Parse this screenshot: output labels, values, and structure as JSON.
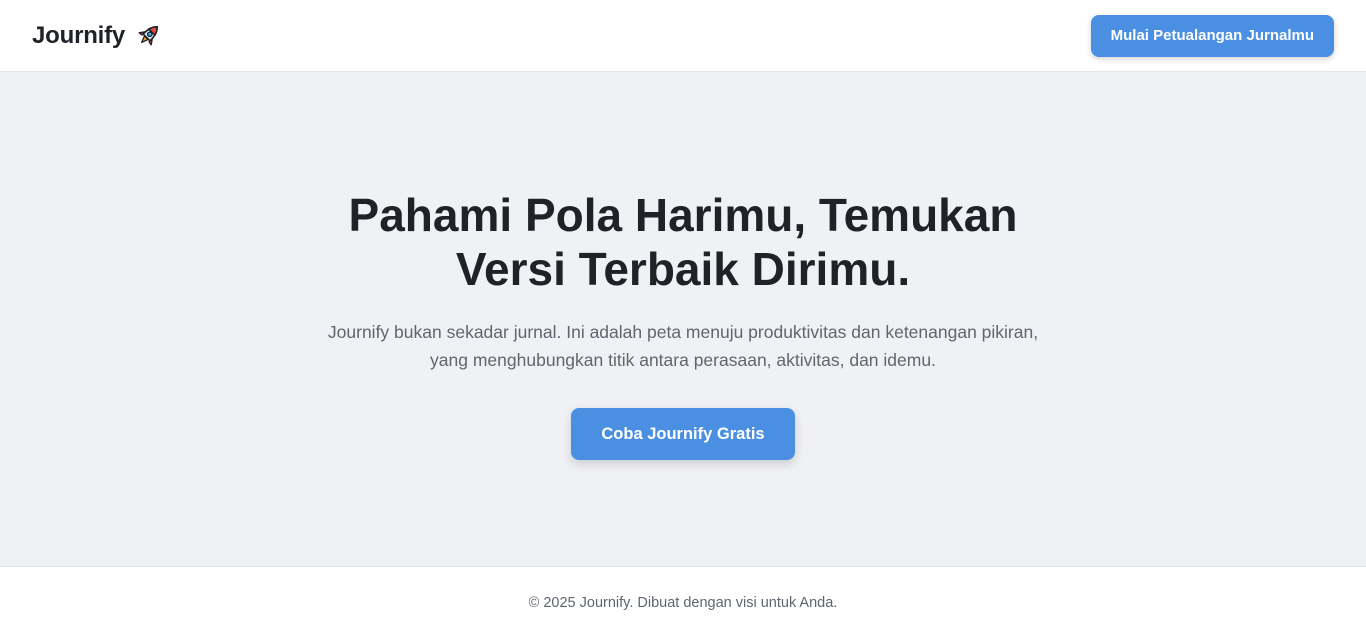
{
  "header": {
    "brand": "Journify",
    "brand_icon": "rocket-icon",
    "cta_label": "Mulai Petualangan Jurnalmu"
  },
  "hero": {
    "title": "Pahami Pola Harimu, Temukan Versi Terbaik Dirimu.",
    "subtitle": "Journify bukan sekadar jurnal. Ini adalah peta menuju produktivitas dan ketenangan pikiran, yang menghubungkan titik antara perasaan, aktivitas, dan idemu.",
    "cta_label": "Coba Journify Gratis"
  },
  "footer": {
    "text": "© 2025 Journify. Dibuat dengan visi untuk Anda."
  },
  "colors": {
    "accent": "#4a8fe2",
    "hero_bg": "#f0f1f5",
    "text_dark": "#1f2328",
    "text_muted": "#5f6670"
  }
}
